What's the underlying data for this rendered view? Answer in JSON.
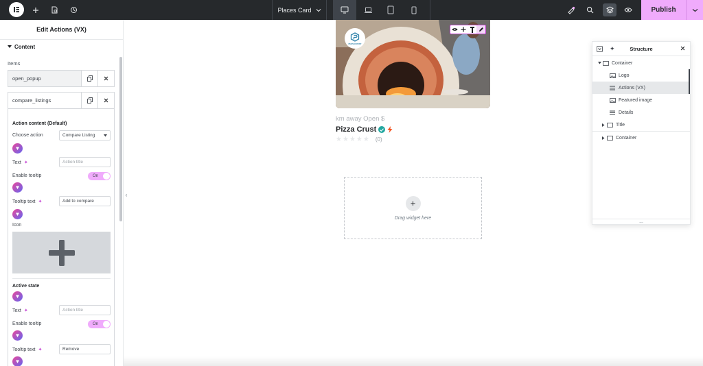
{
  "topbar": {
    "document_title": "Places Card",
    "publish_label": "Publish",
    "icons": [
      "elementor-logo-icon",
      "plus-icon",
      "page-settings-icon",
      "history-icon",
      "desktop-icon",
      "laptop-icon",
      "tablet-icon",
      "mobile-icon",
      "notification-icon",
      "search-icon",
      "structure-icon",
      "preview-icon"
    ]
  },
  "panel": {
    "title": "Edit Actions (VX)",
    "section": "Content",
    "items_label": "Items",
    "items": [
      {
        "name": "open_popup"
      },
      {
        "name": "compare_listings"
      }
    ],
    "action_content_heading": "Action content (Default)",
    "choose_action_label": "Choose action",
    "choose_action_value": "Compare Listing",
    "text_label": "Text",
    "text_placeholder": "Action title",
    "enable_tooltip_label": "Enable tooltip",
    "toggle_on": "On",
    "tooltip_text_label": "Tooltip text",
    "tooltip_text_value": "Add to compare",
    "icon_label": "Icon",
    "active_state_heading": "Active state",
    "active_text_label": "Text",
    "active_text_placeholder": "Action title",
    "active_enable_tooltip_label": "Enable tooltip",
    "active_toggle_on": "On",
    "active_tooltip_text_label": "Tooltip text",
    "active_tooltip_text_value": "Remove"
  },
  "canvas": {
    "logo_text": "PIZZACRUST",
    "card_meta": "km away Open $",
    "card_title": "Pizza Crust",
    "rating_count": "(0)",
    "dropzone_text": "Drag widget here"
  },
  "structure": {
    "title": "Structure",
    "rows": [
      {
        "label": "Container",
        "level": 0,
        "expanded": true
      },
      {
        "label": "Logo",
        "level": 1
      },
      {
        "label": "Actions (VX)",
        "level": 1,
        "selected": true
      },
      {
        "label": "Featured image",
        "level": 1
      },
      {
        "label": "Details",
        "level": 1
      },
      {
        "label": "Title",
        "level": 1,
        "collapsed": true
      },
      {
        "label": "Container",
        "level": 0,
        "collapsed": true
      }
    ],
    "footer": "..."
  },
  "colors": {
    "topbar_bg": "#26292c",
    "publish_bg": "#f0abfc",
    "accent": "#c13bd1",
    "toggle_on": "#f0abfc"
  }
}
